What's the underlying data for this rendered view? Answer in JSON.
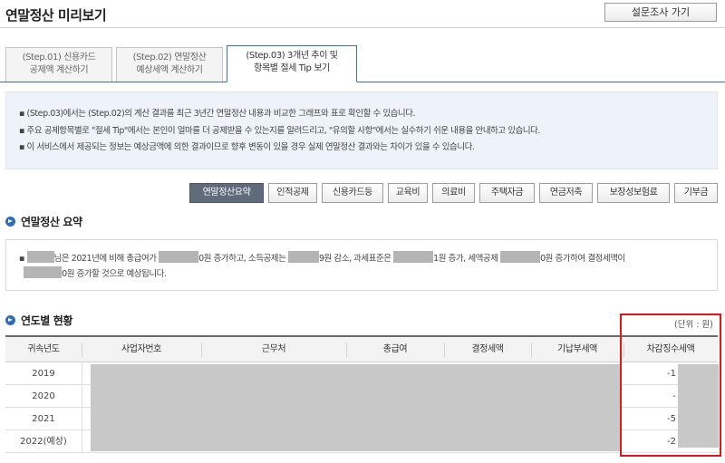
{
  "header": {
    "title": "연말정산 미리보기",
    "survey_button": "설문조사 가기"
  },
  "tabs": [
    {
      "line1": "(Step.01) 신용카드",
      "line2": "공제액 계산하기",
      "active": false
    },
    {
      "line1": "(Step.02) 연말정산",
      "line2": "예상세액 계산하기",
      "active": false
    },
    {
      "line1": "(Step.03) 3개년 추이 및",
      "line2": "항목별 절세 Tip 보기",
      "active": true
    }
  ],
  "info": [
    "▪ (Step.03)에서는 (Step.02)의 계산 결과를 최근 3년간 연말정산 내용과 비교한 그래프와 표로 확인할 수 있습니다.",
    "▪ 주요 공제항목별로 \"절세 Tip\"에서는 본인이 얼마를 더 공제받을 수 있는지를 알려드리고, \"유의할 사항\"에서는 실수하기 쉬운 내용을 안내하고 있습니다.",
    "▪ 이 서비스에서 제공되는 정보는 예상금액에 의한 결과이므로 향후 변동이 있을 경우 실제 연말정산 결과와는 차이가 있을 수 있습니다."
  ],
  "categories": [
    "연말정산요약",
    "인적공제",
    "신용카드등",
    "교육비",
    "의료비",
    "주택자금",
    "연금저축",
    "보장성보험료",
    "기부금"
  ],
  "summary": {
    "title": "연말정산 요약",
    "bullet": "▪",
    "p1": "님은 2021년에 비해 총급여가",
    "p2": "0원 증가하고, 소득공제는",
    "p3": "9원 감소, 과세표준은",
    "p4": "1원 증가, 세액공제",
    "p5": "0원 증가하여 결정세액이",
    "p6": "0원 증가할 것으로 예상됩니다."
  },
  "yearly": {
    "title": "연도별 현황",
    "unit": "(단위 : 원)",
    "columns": [
      "귀속년도",
      "사업자번호",
      "근무처",
      "총급여",
      "결정세액",
      "기납부세액",
      "차감징수세액"
    ],
    "rows": [
      {
        "year": "2019",
        "value": "-1"
      },
      {
        "year": "2020",
        "value": "-"
      },
      {
        "year": "2021",
        "value": "-5"
      },
      {
        "year": "2022(예상)",
        "value": "-2"
      }
    ]
  }
}
